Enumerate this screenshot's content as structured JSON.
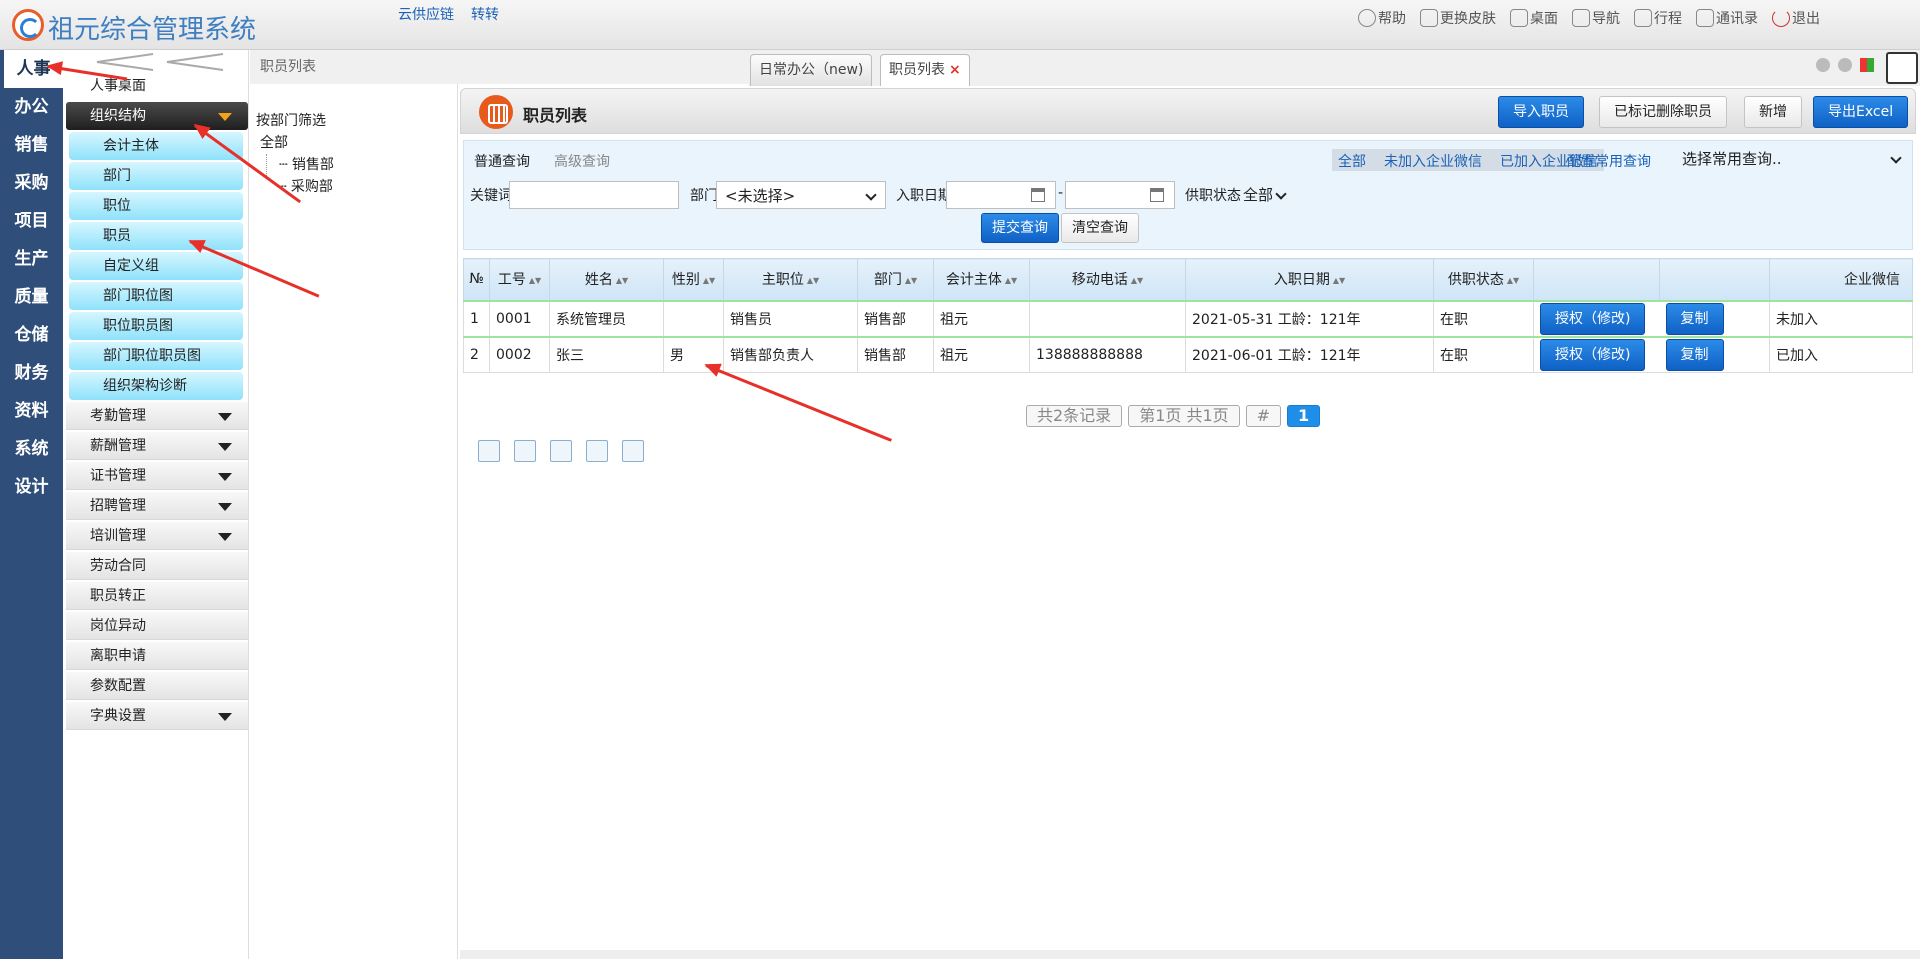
{
  "app": {
    "title": "祖元综合管理系统",
    "links": [
      "云供应链",
      "转转"
    ]
  },
  "topright": [
    {
      "icon": "help-icon",
      "label": "帮助"
    },
    {
      "icon": "shirt-icon",
      "label": "更换皮肤"
    },
    {
      "icon": "home-icon",
      "label": "桌面"
    },
    {
      "icon": "grid-icon",
      "label": "导航"
    },
    {
      "icon": "calendar-icon",
      "label": "行程"
    },
    {
      "icon": "contacts-icon",
      "label": "通讯录"
    },
    {
      "icon": "power-icon",
      "label": "退出"
    }
  ],
  "modules": [
    "人事",
    "办公",
    "销售",
    "采购",
    "项目",
    "生产",
    "质量",
    "仓储",
    "财务",
    "资料",
    "系统",
    "设计"
  ],
  "submenu": {
    "home": "人事桌面",
    "org": "组织结构",
    "org_items": [
      "会计主体",
      "部门",
      "职位",
      "职员",
      "自定义组",
      "部门职位图",
      "职位职员图",
      "部门职位职员图",
      "组织架构诊断"
    ],
    "groups": [
      {
        "label": "考勤管理",
        "arrow": true
      },
      {
        "label": "薪酬管理",
        "arrow": true
      },
      {
        "label": "证书管理",
        "arrow": true
      },
      {
        "label": "招聘管理",
        "arrow": true
      },
      {
        "label": "培训管理",
        "arrow": true
      },
      {
        "label": "劳动合同",
        "arrow": false
      },
      {
        "label": "职员转正",
        "arrow": false
      },
      {
        "label": "岗位异动",
        "arrow": false
      },
      {
        "label": "离职申请",
        "arrow": false
      },
      {
        "label": "参数配置",
        "arrow": false
      },
      {
        "label": "字典设置",
        "arrow": true
      }
    ]
  },
  "breadcrumb": "职员列表",
  "tabs": [
    {
      "label": "日常办公（new)"
    },
    {
      "label": "职员列表"
    }
  ],
  "tree": {
    "title": "按部门筛选",
    "root": "全部",
    "children": [
      "销售部",
      "采购部"
    ]
  },
  "panel": {
    "title": "职员列表",
    "buttons": {
      "import": "导入职员",
      "deleted": "已标记删除职员",
      "add": "新增",
      "export": "导出Excel"
    }
  },
  "query": {
    "tab_normal": "普通查询",
    "tab_advanced": "高级查询",
    "filters": [
      "全部",
      "未加入企业微信",
      "已加入企业微信"
    ],
    "config": "配置常用查询",
    "common_select": "选择常用查询..",
    "keyword_label": "关键词",
    "keyword_value": "",
    "dept_label": "部门",
    "dept_value": "<未选择>",
    "date_label": "入职日期",
    "date_sep": "-",
    "status_label": "供职状态",
    "status_value": "全部",
    "submit": "提交查询",
    "clear": "清空查询"
  },
  "table": {
    "headers": [
      "№",
      "工号",
      "姓名",
      "性别",
      "主职位",
      "部门",
      "会计主体",
      "移动电话",
      "入职日期",
      "供职状态",
      "",
      "",
      "企业微信"
    ],
    "rows": [
      {
        "no": "1",
        "id": "0001",
        "name": "系统管理员",
        "gender": "",
        "position": "销售员",
        "dept": "销售部",
        "entity": "祖元",
        "phone": "",
        "date": "2021-05-31 工龄：121年",
        "status": "在职",
        "wechat": "未加入"
      },
      {
        "no": "2",
        "id": "0002",
        "name": "张三",
        "gender": "男",
        "position": "销售部负责人",
        "dept": "销售部",
        "entity": "祖元",
        "phone": "138888888888",
        "date": "2021-06-01 工龄：121年",
        "status": "在职",
        "wechat": "已加入"
      }
    ],
    "row_buttons": {
      "auth": "授权（修改)",
      "copy": "复制"
    }
  },
  "pager": {
    "total": "共2条记录",
    "pages": "第1页 共1页",
    "hash": "#",
    "current": "1"
  },
  "colors": {
    "nav": "#2f4f7a",
    "accent": "#0f61c5",
    "annotation": "#e8302a"
  }
}
